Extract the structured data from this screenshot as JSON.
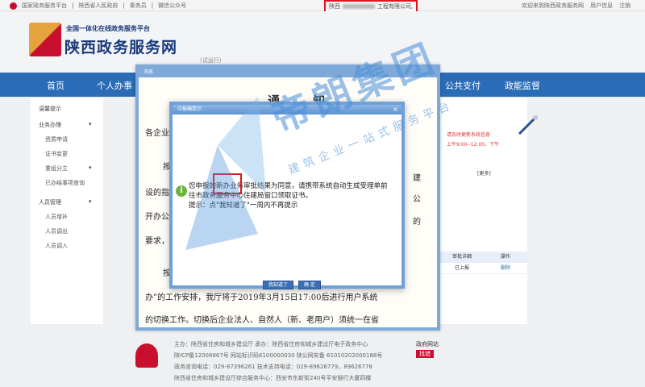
{
  "topbar": {
    "links": [
      "国家政务服务平台",
      "陕西省人民政府",
      "秦务员",
      "微信公众号"
    ],
    "company_prefix": "陕西",
    "company_suffix": "工程有限公司,",
    "welcome": "欢迎来到陕西政务服务网",
    "user_info": "用户信息",
    "logout": "注销"
  },
  "brand": {
    "subtitle": "全国一体化在线政务服务平台",
    "title": "陕西政务服务网",
    "trial": "(试运行)"
  },
  "nav": {
    "items": [
      "首页",
      "个人办事",
      "公共支付",
      "政能监督"
    ]
  },
  "sidebar": {
    "items": [
      {
        "label": "温馨提示",
        "sub": false
      },
      {
        "label": "业务办理",
        "sub": false,
        "expand": "▾"
      },
      {
        "label": "资质申请",
        "sub": true
      },
      {
        "label": "证书变更",
        "sub": true
      },
      {
        "label": "重组分立",
        "sub": true,
        "expand": "▾"
      },
      {
        "label": "已办结事项查询",
        "sub": true
      },
      {
        "label": "人员管理",
        "sub": false,
        "expand": "▾"
      },
      {
        "label": "人员增补",
        "sub": true
      },
      {
        "label": "人员调出",
        "sub": true
      },
      {
        "label": "人员调入",
        "sub": true
      }
    ]
  },
  "notice": {
    "window_title": "消息",
    "title": "通 知",
    "lines": [
      "各企业：",
      "按",
      "设的指",
      "开办公",
      "要求，",
      "按",
      "办”的工作安排，我厅将于2019年3月15日17:00后进行用户系统",
      "的切换工作。切换后企业法人、自然人（新、老用户）须统一在省"
    ],
    "fragments": [
      "建",
      "公",
      "的"
    ]
  },
  "rightpanel": {
    "red_line_1": "请及时更新系统信息",
    "red_line_2": "上午9:00--12:00，下午",
    "more": "[更多]",
    "table_headers": [
      "审批详细",
      "操作"
    ],
    "table_row": [
      "已上报",
      "删除"
    ]
  },
  "dialog": {
    "title": "中报确提示",
    "message_line_1": "您申报的新办业务审批结果为同意，请携带系统自动生成受理单前",
    "message_line_2": "往市政务服务中心住建局窗口领取证书。",
    "message_line_3": "提示：点\"我知道了\"一周内不再提示",
    "btn_ack": "我知道了",
    "btn_ok": "确 定",
    "close": "×"
  },
  "footer": {
    "line_1": "主办：陕西省住房和城乡建设厅  承办：陕西省住房和城乡建设厅电子政务中心",
    "line_2": "陕ICP备12008867号  网站标识码6100000030  陕公网安备 61010202000188号",
    "line_3": "政务咨询电话：029-87396261 技术支持电话：029-89626779，89626778",
    "line_4": "陕西省住房和城乡建设厅综合服务中心：西安市东新街240号平安银行大厦四楼",
    "err_label": "政府网站",
    "err_badge": "找错"
  },
  "watermark": {
    "text": "帝朗集团",
    "slogan": "建筑企业一站式服务平台"
  },
  "colors": {
    "nav_blue": "#2b6cb6",
    "highlight_red": "#e0141e",
    "dialog_border": "#6fa0d8"
  }
}
